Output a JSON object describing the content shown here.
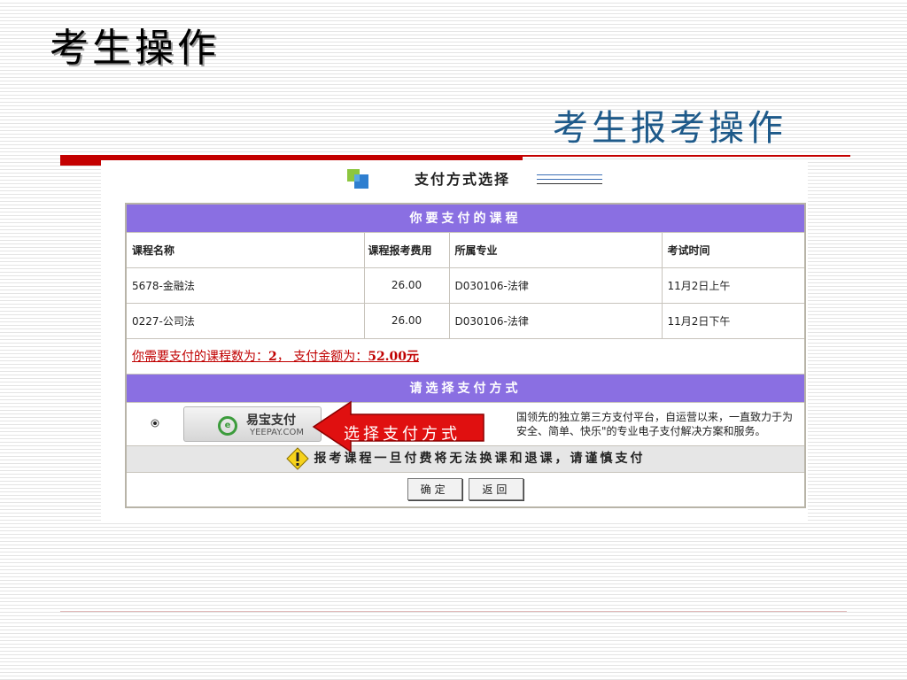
{
  "slide": {
    "title": "考生操作",
    "subtitle": "考生报考操作"
  },
  "page": {
    "heading": "支付方式选择"
  },
  "courses_table": {
    "band_title": "你要支付的课程",
    "columns": [
      "课程名称",
      "课程报考费用",
      "所属专业",
      "考试时间"
    ],
    "rows": [
      [
        "5678-金融法",
        "26.00",
        "D030106-法律",
        "11月2日上午"
      ],
      [
        "0227-公司法",
        "26.00",
        "D030106-法律",
        "11月2日下午"
      ]
    ],
    "summary_prefix": "你需要支付的课程数为：",
    "summary_count": "2",
    "summary_mid": "， 支付金额为：",
    "summary_amount": "52.00元"
  },
  "payment": {
    "band_title": "请选择支付方式",
    "option_cn": "易宝支付",
    "option_en": "YEEPAY.COM",
    "description_line1": "国领先的独立第三方支付平台，自运营以来，一直致力于为",
    "description_line2": "安全、简单、快乐\"的专业电子支付解决方案和服务。"
  },
  "warning": "报考课程一旦付费将无法换课和退课，请谨慎支付",
  "buttons": {
    "confirm": "确定",
    "back": "返回"
  },
  "callout": "选择支付方式",
  "colors": {
    "band": "#8a6fe2",
    "accent_red": "#c40000",
    "subtitle_blue": "#1e5a8a",
    "warn_bg": "#e6e6e6"
  },
  "icons": [
    "payment-method-icon",
    "yeepay-logo-icon",
    "warning-icon",
    "red-arrow-callout"
  ]
}
